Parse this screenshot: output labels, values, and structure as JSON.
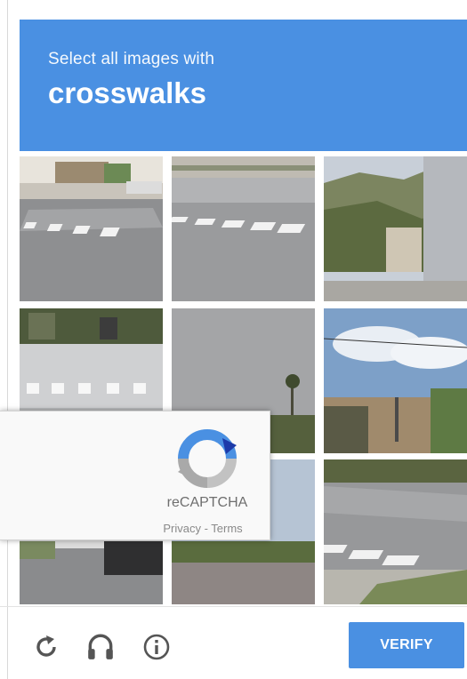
{
  "challenge": {
    "instruction": "Select all images with",
    "target": "crosswalks"
  },
  "grid": {
    "tiles": [
      {
        "label": "street corner with crosswalk stripes"
      },
      {
        "label": "road with crosswalk"
      },
      {
        "label": "hills and building"
      },
      {
        "label": "sidewalk with crosswalk stripes"
      },
      {
        "label": "asphalt and palm tree"
      },
      {
        "label": "cloudy sky and buildings"
      },
      {
        "label": "road with parked car"
      },
      {
        "label": "sky over trees"
      },
      {
        "label": "street with crosswalk"
      }
    ]
  },
  "badge": {
    "brand": "reCAPTCHA",
    "privacy": "Privacy",
    "separator": " - ",
    "terms": "Terms"
  },
  "footer": {
    "icons": [
      "reload-icon",
      "audio-headphones-icon",
      "info-icon"
    ],
    "verify_label": "VERIFY"
  },
  "colors": {
    "accent": "#4a90e2",
    "badge_background": "#f9f9f9"
  }
}
